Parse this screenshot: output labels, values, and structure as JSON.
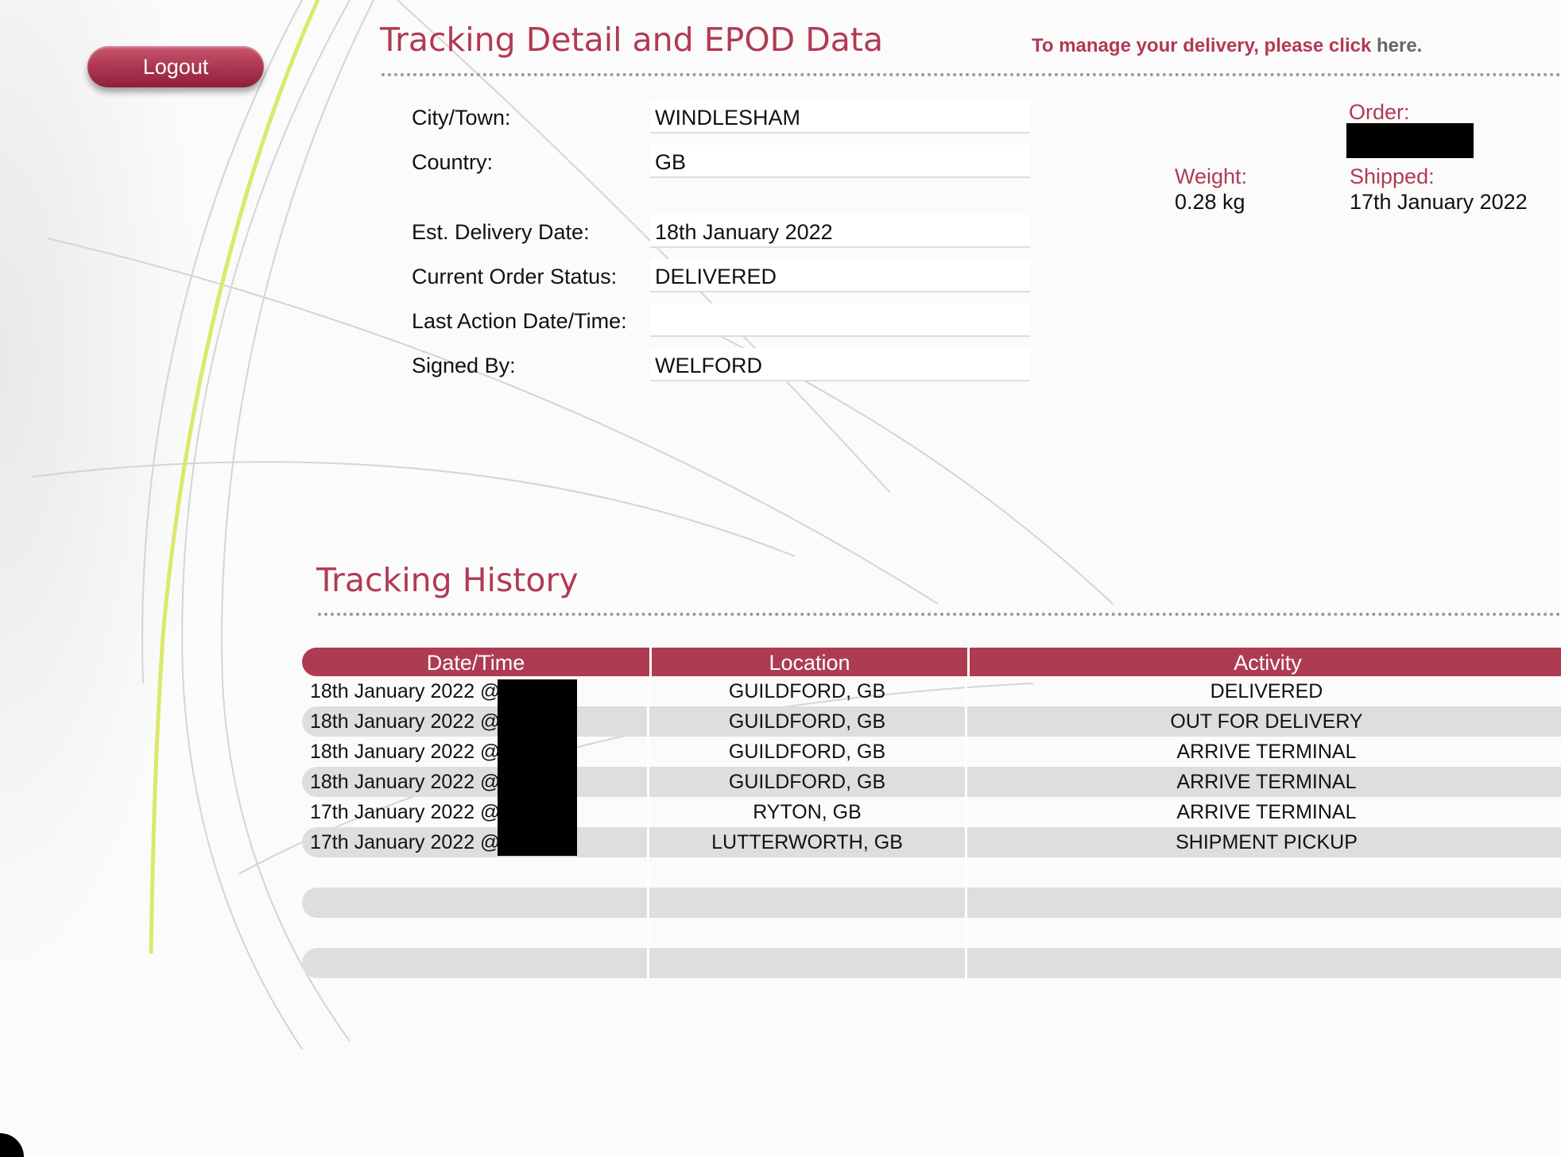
{
  "logout_label": "Logout",
  "detail": {
    "title": "Tracking Detail and EPOD Data",
    "manage_text": "To manage your delivery, please click",
    "manage_link": "here.",
    "fields": [
      {
        "label": "City/Town:",
        "value": "WINDLESHAM"
      },
      {
        "label": "Country:",
        "value": "GB"
      },
      {
        "label": "Est. Delivery Date:",
        "value": "18th January 2022"
      },
      {
        "label": "Current Order Status:",
        "value": "DELIVERED"
      },
      {
        "label": "Last Action Date/Time:",
        "value": ""
      },
      {
        "label": "Signed By:",
        "value": "WELFORD"
      }
    ],
    "order_label": "Order:",
    "weight_label": "Weight:",
    "weight_value": "0.28 kg",
    "shipped_label": "Shipped:",
    "shipped_value": "17th January 2022"
  },
  "history": {
    "title": "Tracking History",
    "columns": [
      "Date/Time",
      "Location",
      "Activity"
    ],
    "rows": [
      {
        "date": "18th January 2022 @",
        "location": "GUILDFORD, GB",
        "activity": "DELIVERED"
      },
      {
        "date": "18th January 2022 @",
        "location": "GUILDFORD, GB",
        "activity": "OUT FOR DELIVERY"
      },
      {
        "date": "18th January 2022 @",
        "location": "GUILDFORD, GB",
        "activity": "ARRIVE TERMINAL"
      },
      {
        "date": "18th January 2022 @",
        "location": "GUILDFORD, GB",
        "activity": "ARRIVE TERMINAL"
      },
      {
        "date": "17th January 2022 @",
        "location": "RYTON, GB",
        "activity": "ARRIVE TERMINAL"
      },
      {
        "date": "17th January 2022 @",
        "location": "LUTTERWORTH, GB",
        "activity": "SHIPMENT PICKUP"
      }
    ]
  },
  "colors": {
    "accent": "#b13a52",
    "header_bg": "#ad3c53",
    "row_alt": "#dedede",
    "link_gray": "#666666"
  }
}
